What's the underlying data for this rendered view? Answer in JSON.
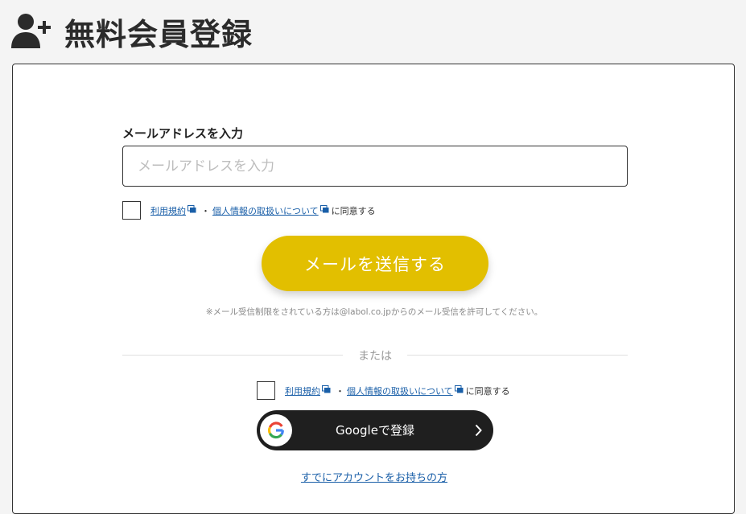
{
  "header": {
    "title": "無料会員登録",
    "icon": "user-plus-icon"
  },
  "form": {
    "email_label": "メールアドレスを入力",
    "email_placeholder": "メールアドレスを入力",
    "email_value": "",
    "terms_link": "利用規約",
    "separator": "・",
    "privacy_link": "個人情報の取扱いについて",
    "agree_suffix": "に同意する",
    "send_button": "メールを送信する",
    "note": "※メール受信制限をされている方は@labol.co.jpからのメール受信を許可してください。"
  },
  "divider": {
    "label": "または"
  },
  "google": {
    "button_label": "Googleで登録"
  },
  "footer": {
    "login_link": "すでにアカウントをお持ちの方"
  },
  "colors": {
    "accent": "#e2bf00",
    "link": "#1a5fa8",
    "google_button": "#1f1f1f",
    "text": "#333333"
  }
}
